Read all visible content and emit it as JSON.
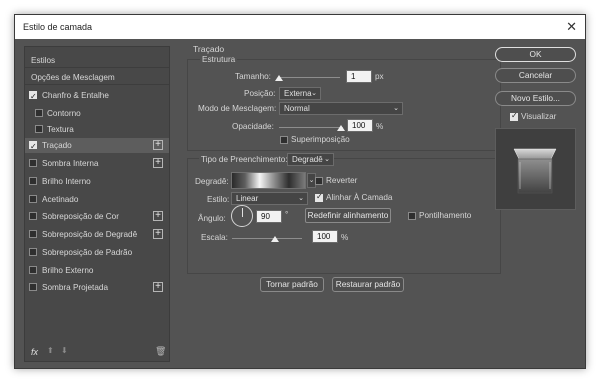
{
  "window": {
    "title": "Estilo de camada"
  },
  "left_panel": {
    "items": [
      {
        "label": "Estilos",
        "checkbox": false,
        "checked": false,
        "plus": false,
        "indent": false
      },
      {
        "label": "Opções de Mesclagem",
        "checkbox": false,
        "checked": false,
        "plus": false,
        "indent": false
      },
      {
        "label": "Chanfro & Entalhe",
        "checkbox": true,
        "checked": true,
        "plus": false,
        "indent": false
      },
      {
        "label": "Contorno",
        "checkbox": true,
        "checked": false,
        "plus": false,
        "indent": true
      },
      {
        "label": "Textura",
        "checkbox": true,
        "checked": false,
        "plus": false,
        "indent": true
      },
      {
        "label": "Traçado",
        "checkbox": true,
        "checked": true,
        "plus": true,
        "indent": false,
        "selected": true
      },
      {
        "label": "Sombra Interna",
        "checkbox": true,
        "checked": false,
        "plus": true,
        "indent": false
      },
      {
        "label": "Brilho Interno",
        "checkbox": true,
        "checked": false,
        "plus": false,
        "indent": false
      },
      {
        "label": "Acetinado",
        "checkbox": true,
        "checked": false,
        "plus": false,
        "indent": false
      },
      {
        "label": "Sobreposição de Cor",
        "checkbox": true,
        "checked": false,
        "plus": true,
        "indent": false
      },
      {
        "label": "Sobreposição de Degradê",
        "checkbox": true,
        "checked": false,
        "plus": true,
        "indent": false
      },
      {
        "label": "Sobreposição de Padrão",
        "checkbox": true,
        "checked": false,
        "plus": false,
        "indent": false
      },
      {
        "label": "Brilho Externo",
        "checkbox": true,
        "checked": false,
        "plus": false,
        "indent": false
      },
      {
        "label": "Sombra Projetada",
        "checkbox": true,
        "checked": false,
        "plus": true,
        "indent": false
      }
    ],
    "footer": {
      "fx": "fx"
    }
  },
  "stroke": {
    "section_title": "Traçado",
    "structure_title": "Estrutura",
    "size_label": "Tamanho:",
    "size_value": "1",
    "size_unit": "px",
    "position_label": "Posição:",
    "position_value": "Externa",
    "blend_label": "Modo de Mesclagem:",
    "blend_value": "Normal",
    "opacity_label": "Opacidade:",
    "opacity_value": "100",
    "opacity_unit": "%",
    "overprint_label": "Superimposição",
    "fill_type_label": "Tipo de Preenchimento:",
    "fill_type_value": "Degradê",
    "gradient_label": "Degradê:",
    "reverse_label": "Reverter",
    "style_label": "Estilo:",
    "style_value": "Linear",
    "align_label": "Alinhar À Camada",
    "angle_label": "Ângulo:",
    "angle_value": "90",
    "angle_unit": "°",
    "reset_align_label": "Redefinir alinhamento",
    "dither_label": "Pontilhamento",
    "scale_label": "Escala:",
    "scale_value": "100",
    "scale_unit": "%",
    "make_default_label": "Tornar padrão",
    "reset_default_label": "Restaurar padrão"
  },
  "right": {
    "ok_label": "OK",
    "cancel_label": "Cancelar",
    "new_style_label": "Novo Estilo...",
    "preview_label": "Visualizar"
  }
}
